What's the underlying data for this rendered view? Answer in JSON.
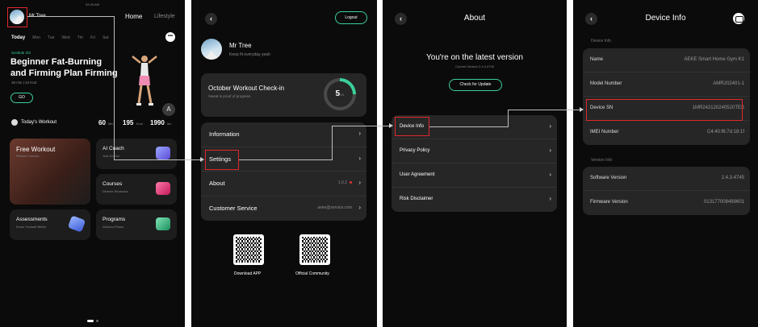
{
  "home": {
    "time": "09:26 AM",
    "username": "Mr Tree",
    "tabs": [
      "Home",
      "Lifestyle"
    ],
    "days": [
      "Today",
      "Mon",
      "Tue",
      "Wed",
      "Thr",
      "Fri",
      "Sat"
    ],
    "more_icon": "•••",
    "schedule": "Scedule 2/3",
    "plan_title_1": "Beginner Fat-Burning",
    "plan_title_2": "and Firming Plan Firming",
    "plan_meta": "38 min  |  42 kcal",
    "go_label": "GO",
    "assistant_letter": "A",
    "todays_workout": "Today's Workout",
    "stat_min_value": "60",
    "stat_min_unit": "Min",
    "stat_kcal_value": "195",
    "stat_kcal_unit": "Kcal",
    "stat_lbs_value": "1990",
    "stat_lbs_unit": "lbs",
    "cards": {
      "free_workout": {
        "title": "Free Workout",
        "sub": "Fitness Commu..."
      },
      "ai_coach": {
        "title": "AI Coach",
        "sub": "Just for You"
      },
      "courses": {
        "title": "Courses",
        "sub": "Diverse Workouts"
      },
      "assessments": {
        "title": "Assessments",
        "sub": "Know Yourself Better"
      },
      "programs": {
        "title": "Programs",
        "sub": "Workout Plans"
      }
    }
  },
  "settings": {
    "logout_label": "Logout",
    "username": "Mr Tree",
    "tagline": "Keep fit everyday yeah",
    "checkin_title": "October Workout Check-in",
    "checkin_sub": "Sweat is proof of progress",
    "checkin_count": "5",
    "checkin_total": "/31",
    "checkin_progress": 0.25,
    "menu": [
      {
        "label": "Information",
        "value": ""
      },
      {
        "label": "Settings",
        "value": ""
      },
      {
        "label": "About",
        "value": "1.0.2"
      },
      {
        "label": "Customer Service",
        "value": "aeke@service.com"
      }
    ],
    "qr_download": "Download APP",
    "qr_community": "Official Community"
  },
  "about": {
    "title": "About",
    "status": "You're on the latest version",
    "version_line": "Current Version 2.4.3.4745",
    "update_label": "Check for Update",
    "items": [
      "Device Info",
      "Privacy Policy",
      "User Agreement",
      "Risk Disclaimer"
    ]
  },
  "device": {
    "title": "Device Info",
    "device_section": "Device Info",
    "device_rows": [
      {
        "k": "Name",
        "v": "AEKE Smart Home Gym K1"
      },
      {
        "k": "Model Number",
        "v": "AMR202401-1"
      },
      {
        "k": "Device SN",
        "v": "1MR242120240520TES"
      },
      {
        "k": "IMEI Number",
        "v": "C4:40:f6:7d:18:1f"
      }
    ],
    "version_section": "Version Info",
    "version_rows": [
      {
        "k": "Software Version",
        "v": "2.4.3.4745"
      },
      {
        "k": "Firmware Version",
        "v": "013177008499601"
      }
    ]
  },
  "colors": {
    "accent": "#3ad19a",
    "highlight": "#e0282a",
    "panel": "#0b0b0b",
    "card": "#262626"
  },
  "icons": [
    "chevron-left-icon",
    "chevron-right-icon",
    "more-icon",
    "home-icon",
    "clock-icon",
    "qr-code-icon"
  ]
}
